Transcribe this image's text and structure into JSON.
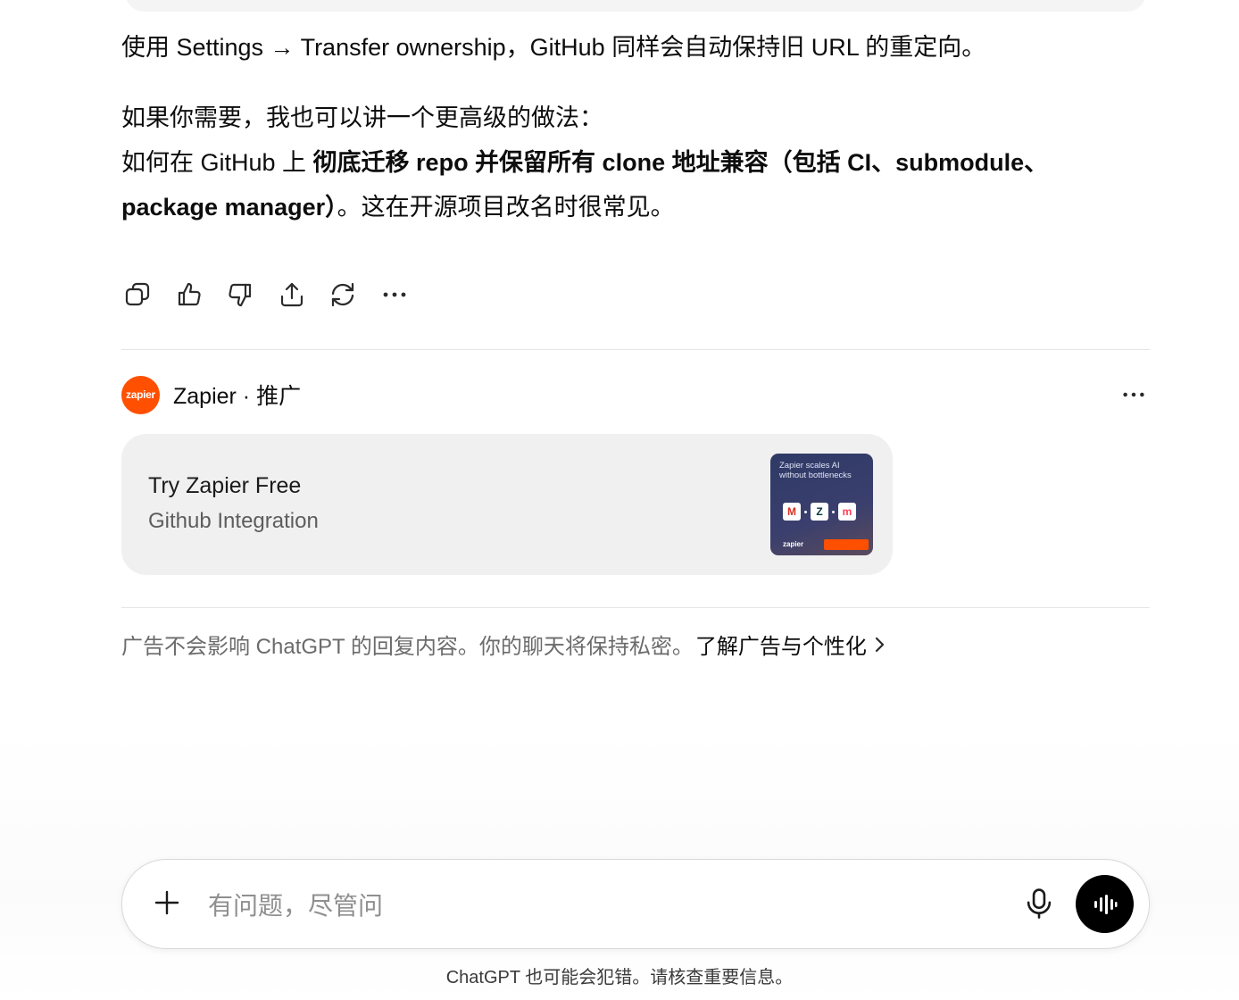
{
  "message": {
    "line1": "使用 Settings → Transfer ownership，GitHub 同样会自动保持旧 URL 的重定向。",
    "offer_intro": "如果你需要，我也可以讲一个更高级的做法：",
    "offer_prefix": "如何在 GitHub 上 ",
    "offer_bold_a": "彻底迁移 repo 并保留所有 clone 地址兼容（包括 CI、submodule、",
    "offer_bold_b": "package manager）",
    "offer_suffix": "。这在开源项目改名时很常见。"
  },
  "message_actions": [
    {
      "icon": "copy-icon"
    },
    {
      "icon": "thumbs-up-icon"
    },
    {
      "icon": "thumbs-down-icon"
    },
    {
      "icon": "share-icon"
    },
    {
      "icon": "regenerate-icon"
    },
    {
      "icon": "more-horizontal-icon"
    }
  ],
  "ad": {
    "logo_text": "zapier",
    "sponsor": "Zapier · 推广",
    "title": "Try Zapier Free",
    "subtitle": "Github Integration",
    "thumb_text": "Zapier scales AI without bottlenecks",
    "thumb_logo": "zapier",
    "brand_color": "#ff4f00"
  },
  "disclaimer": {
    "text": "广告不会影响 ChatGPT 的回复内容。你的聊天将保持私密。",
    "link": "了解广告与个性化"
  },
  "composer": {
    "placeholder": "有问题，尽管问"
  },
  "footer_note": "ChatGPT 也可能会犯错。请核查重要信息。"
}
